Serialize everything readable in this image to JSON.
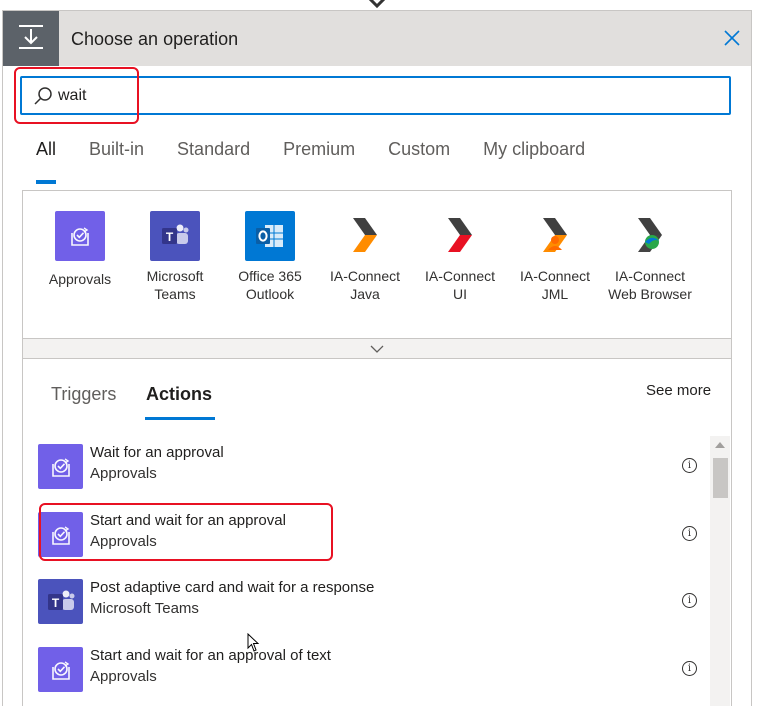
{
  "header": {
    "title": "Choose an operation",
    "icon": "operation-step-icon",
    "close_icon": "close-icon"
  },
  "search": {
    "value": "wait",
    "placeholder": "",
    "icon": "search-icon"
  },
  "tabs": [
    {
      "label": "All",
      "active": true
    },
    {
      "label": "Built-in",
      "active": false
    },
    {
      "label": "Standard",
      "active": false
    },
    {
      "label": "Premium",
      "active": false
    },
    {
      "label": "Custom",
      "active": false
    },
    {
      "label": "My clipboard",
      "active": false
    }
  ],
  "connectors": [
    {
      "label": "Approvals",
      "icon": "approvals-icon",
      "color": "#7160e8"
    },
    {
      "label": "Microsoft Teams",
      "icon": "teams-icon",
      "color": "#4b53bc"
    },
    {
      "label": "Office 365 Outlook",
      "icon": "outlook-icon",
      "color": "#0078d4"
    },
    {
      "label": "IA-Connect Java",
      "icon": "ia-connect-java-icon",
      "color": "#ff8c00"
    },
    {
      "label": "IA-Connect UI",
      "icon": "ia-connect-ui-icon",
      "color": "#e81123"
    },
    {
      "label": "IA-Connect JML",
      "icon": "ia-connect-jml-icon",
      "color": "#ff8c00"
    },
    {
      "label": "IA-Connect Web Browser",
      "icon": "ia-connect-web-browser-icon",
      "color": "#2aa84a"
    }
  ],
  "subtabs": [
    {
      "label": "Triggers",
      "active": false
    },
    {
      "label": "Actions",
      "active": true
    }
  ],
  "see_more": "See more",
  "actions": [
    {
      "title": "Wait for an approval",
      "connector": "Approvals",
      "icon": "approvals-icon",
      "color": "#7160e8"
    },
    {
      "title": "Start and wait for an approval",
      "connector": "Approvals",
      "icon": "approvals-icon",
      "color": "#7160e8"
    },
    {
      "title": "Post adaptive card and wait for a response",
      "connector": "Microsoft Teams",
      "icon": "teams-icon",
      "color": "#4b53bc"
    },
    {
      "title": "Start and wait for an approval of text",
      "connector": "Approvals",
      "icon": "approvals-icon",
      "color": "#7160e8"
    }
  ],
  "info_glyph": "i"
}
